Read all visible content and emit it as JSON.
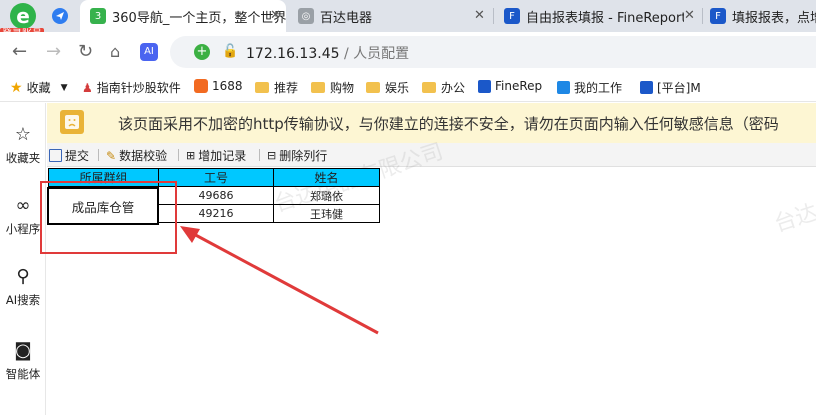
{
  "browser": {
    "login_badge": "登录账号",
    "tabs": [
      {
        "label": "360导航_一个主页，整个世界",
        "icon": "360-navigation-icon"
      },
      {
        "label": "百达电器",
        "icon": "globe-icon"
      },
      {
        "label": "自由报表填报 - FineReport",
        "icon": "finereport-icon"
      },
      {
        "label": "填报报表，点增加",
        "icon": "finereport-icon"
      }
    ],
    "url_host": "172.16.13.45",
    "url_path": " / 人员配置"
  },
  "bookmarks": {
    "favorites": "收藏",
    "items": [
      "指南针炒股软件",
      "1688",
      "推荐",
      "购物",
      "娱乐",
      "办公",
      "FineRep",
      "我的工作",
      "[平台]M"
    ]
  },
  "sidebar": {
    "items": [
      "收藏夹",
      "小程序",
      "AI搜索",
      "智能体"
    ]
  },
  "warning": {
    "text": "该页面采用不加密的http传输协议，与你建立的连接不安全，请勿在页面内输入任何敏感信息（密码"
  },
  "toolbar": {
    "submit": "提交",
    "validate": "数据校验",
    "add_record": "增加记录",
    "delete_row": "删除列行"
  },
  "table": {
    "headers": [
      "所属群组",
      "工号",
      "姓名"
    ],
    "rows": [
      {
        "group": "",
        "id": "49686",
        "name": "郑璐依"
      },
      {
        "group": "",
        "id": "49216",
        "name": "王玮健"
      }
    ],
    "editor_value": "成品库仓管"
  },
  "watermark": "台达电器有限公司"
}
